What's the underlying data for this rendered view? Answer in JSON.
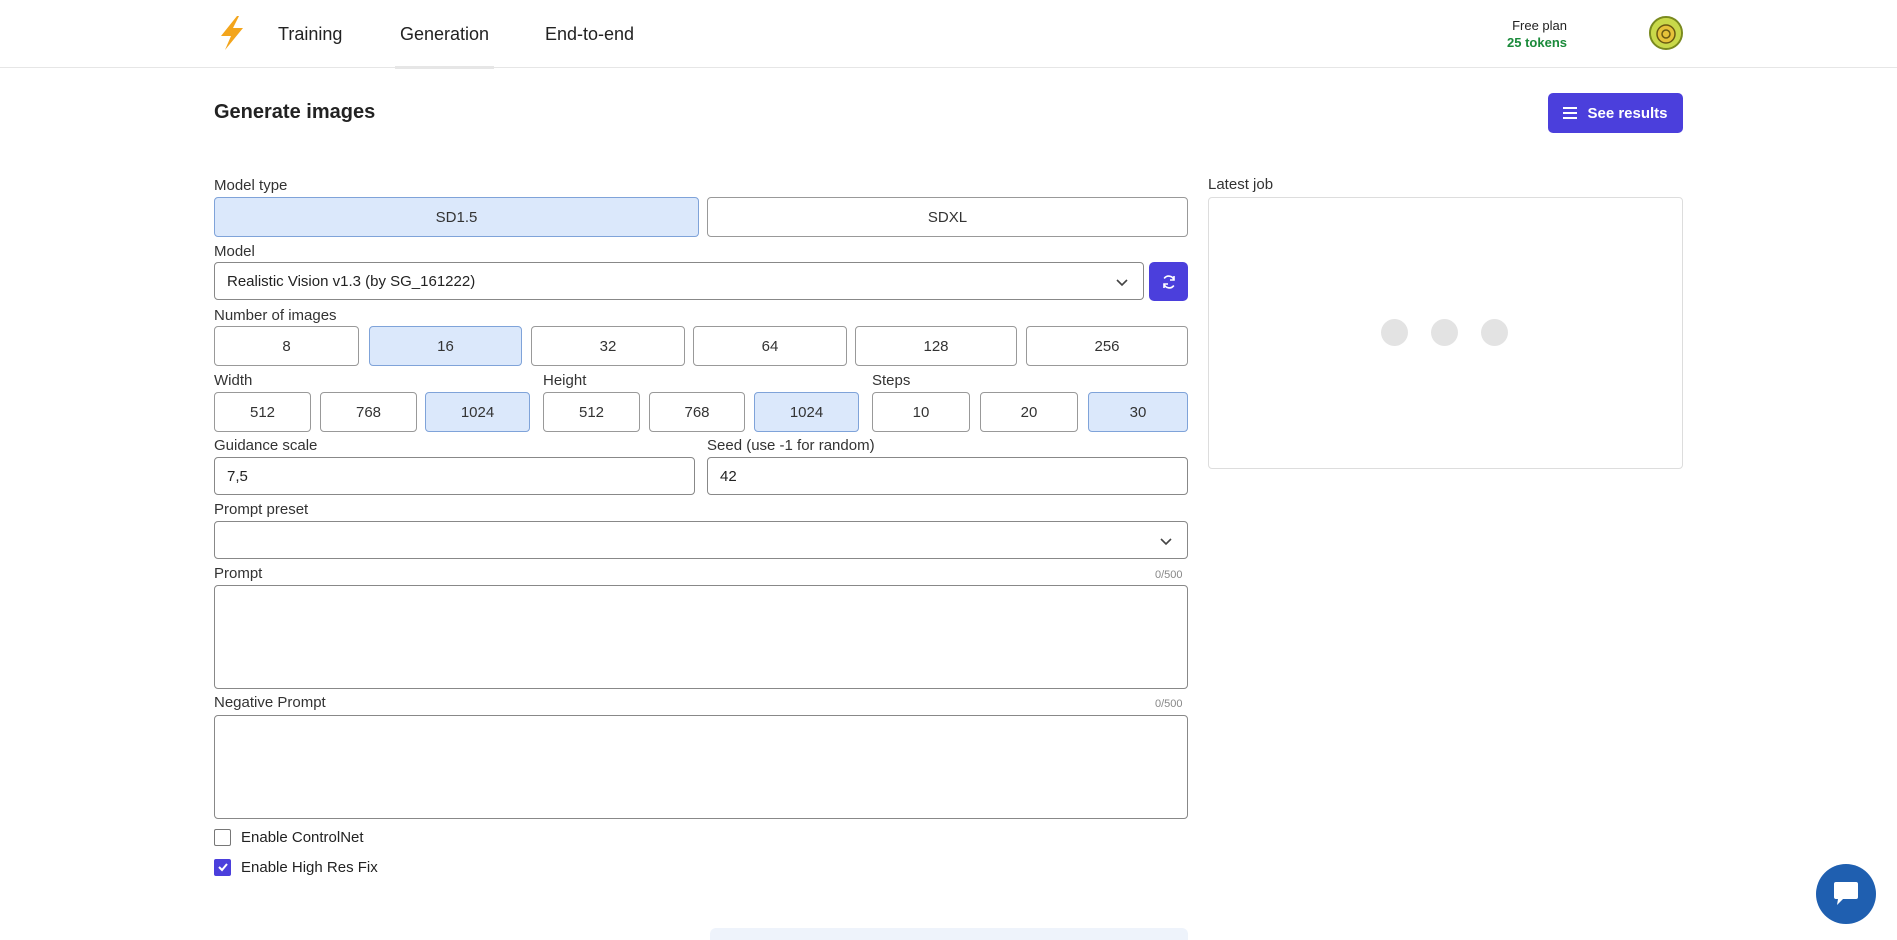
{
  "nav": {
    "tabs": [
      {
        "label": "Training"
      },
      {
        "label": "Generation",
        "active": true
      },
      {
        "label": "End-to-end"
      }
    ]
  },
  "account": {
    "plan": "Free plan",
    "tokens": "25 tokens"
  },
  "page": {
    "title": "Generate images",
    "see_results_label": "See results"
  },
  "form": {
    "model_type": {
      "label": "Model type",
      "options": [
        "SD1.5",
        "SDXL"
      ],
      "selected": "SD1.5"
    },
    "model": {
      "label": "Model",
      "value": "Realistic Vision v1.3 (by SG_161222)"
    },
    "num_images": {
      "label": "Number of images",
      "options": [
        "8",
        "16",
        "32",
        "64",
        "128",
        "256"
      ],
      "selected": "16"
    },
    "width": {
      "label": "Width",
      "options": [
        "512",
        "768",
        "1024"
      ],
      "selected": "1024"
    },
    "height": {
      "label": "Height",
      "options": [
        "512",
        "768",
        "1024"
      ],
      "selected": "1024"
    },
    "steps": {
      "label": "Steps",
      "options": [
        "10",
        "20",
        "30"
      ],
      "selected": "30"
    },
    "guidance_scale": {
      "label": "Guidance scale",
      "value": "7,5"
    },
    "seed": {
      "label": "Seed (use -1 for random)",
      "value": "42"
    },
    "prompt_preset": {
      "label": "Prompt preset",
      "value": ""
    },
    "prompt": {
      "label": "Prompt",
      "counter": "0/500",
      "value": ""
    },
    "negative_prompt": {
      "label": "Negative Prompt",
      "counter": "0/500",
      "value": ""
    },
    "controlnet": {
      "label": "Enable ControlNet",
      "checked": false
    },
    "high_res_fix": {
      "label": "Enable High Res Fix",
      "checked": true
    }
  },
  "latest_job": {
    "label": "Latest job"
  },
  "colors": {
    "accent": "#4b3fdc",
    "selected_bg": "#dbe8fb",
    "tokens_green": "#1a8a3a",
    "chat": "#1f5fb0"
  },
  "icons": {
    "logo": "lightning-bolt-icon",
    "see_results": "list-icon",
    "refresh": "refresh-icon",
    "dropdown": "chevron-down-icon",
    "chat": "chat-bubble-icon",
    "check": "checkmark-icon"
  }
}
